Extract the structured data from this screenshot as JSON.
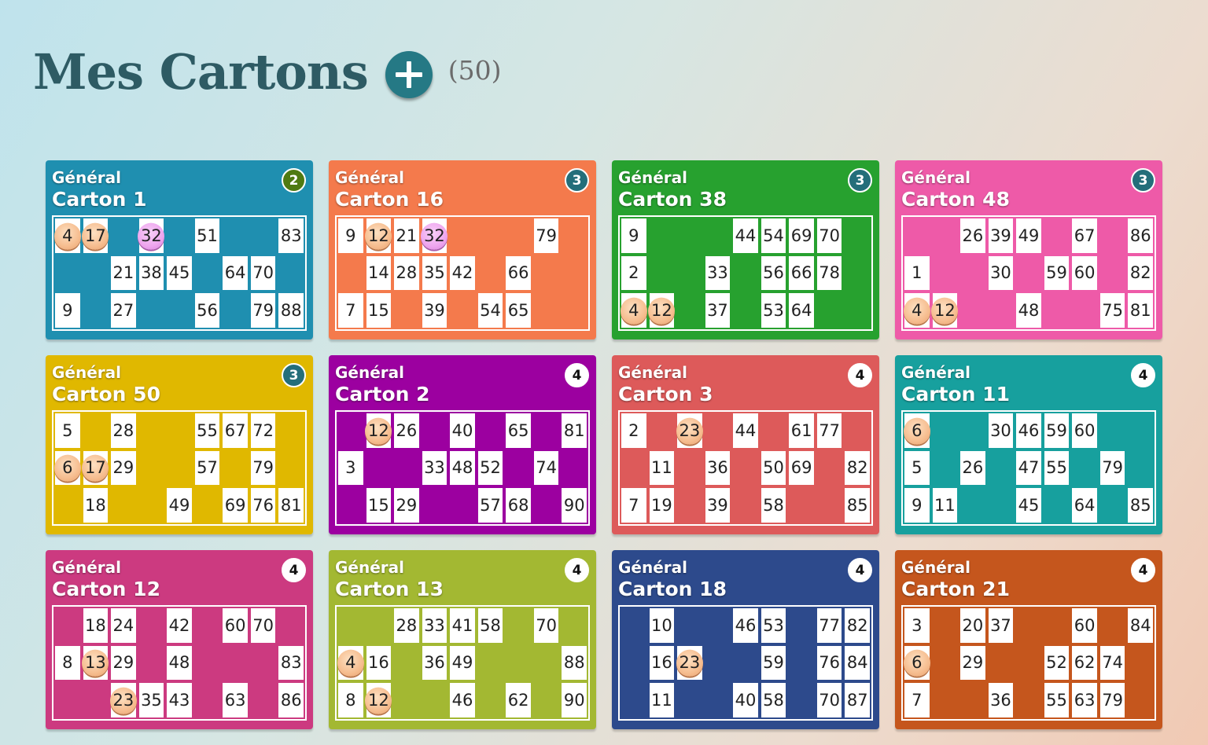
{
  "header": {
    "title": "Mes Cartons",
    "count": "(50)"
  },
  "icons": {
    "add": "plus-icon"
  },
  "cards": [
    {
      "category": "Général",
      "title": "Carton 1",
      "badge": "2",
      "color": "#1f8fb0",
      "badge_color": "#4f7a12",
      "rows": [
        [
          "4*",
          "17*",
          "",
          "32p",
          "",
          "51",
          "",
          "",
          "83"
        ],
        [
          "",
          "",
          "21",
          "38",
          "45",
          "",
          "64",
          "70",
          ""
        ],
        [
          "9",
          "",
          "27",
          "",
          "",
          "56",
          "",
          "79",
          "88"
        ]
      ]
    },
    {
      "category": "Général",
      "title": "Carton 16",
      "badge": "3",
      "color": "#f47a4c",
      "badge_color": "#246e7a",
      "rows": [
        [
          "9",
          "12*",
          "21",
          "32p",
          "",
          "",
          "",
          "79",
          ""
        ],
        [
          "",
          "14",
          "28",
          "35",
          "42",
          "",
          "66",
          "",
          ""
        ],
        [
          "7",
          "15",
          "",
          "39",
          "",
          "54",
          "65",
          "",
          ""
        ]
      ]
    },
    {
      "category": "Général",
      "title": "Carton 38",
      "badge": "3",
      "color": "#27a12f",
      "badge_color": "#246e7a",
      "rows": [
        [
          "9",
          "",
          "",
          "",
          "44",
          "54",
          "69",
          "70",
          ""
        ],
        [
          "2",
          "",
          "",
          "33",
          "",
          "56",
          "66",
          "78",
          ""
        ],
        [
          "4*",
          "12*",
          "",
          "37",
          "",
          "53",
          "64",
          "",
          ""
        ]
      ]
    },
    {
      "category": "Général",
      "title": "Carton 48",
      "badge": "3",
      "color": "#ee5aa8",
      "badge_color": "#246e7a",
      "rows": [
        [
          "",
          "",
          "26",
          "39",
          "49",
          "",
          "67",
          "",
          "86"
        ],
        [
          "1",
          "",
          "",
          "30",
          "",
          "59",
          "60",
          "",
          "82"
        ],
        [
          "4*",
          "12*",
          "",
          "",
          "48",
          "",
          "",
          "75",
          "81"
        ]
      ]
    },
    {
      "category": "Général",
      "title": "Carton 50",
      "badge": "3",
      "color": "#e0b800",
      "badge_color": "#246e7a",
      "rows": [
        [
          "5",
          "",
          "28",
          "",
          "",
          "55",
          "67",
          "72",
          ""
        ],
        [
          "6*",
          "17*",
          "29",
          "",
          "",
          "57",
          "",
          "79",
          ""
        ],
        [
          "",
          "18",
          "",
          "",
          "49",
          "",
          "69",
          "76",
          "81"
        ]
      ]
    },
    {
      "category": "Général",
      "title": "Carton 2",
      "badge": "4",
      "color": "#9c00a0",
      "badge_color": "#ffffff",
      "rows": [
        [
          "",
          "12*",
          "26",
          "",
          "40",
          "",
          "65",
          "",
          "81"
        ],
        [
          "3",
          "",
          "",
          "33",
          "48",
          "52",
          "",
          "74",
          ""
        ],
        [
          "",
          "15",
          "29",
          "",
          "",
          "57",
          "68",
          "",
          "90"
        ]
      ]
    },
    {
      "category": "Général",
      "title": "Carton 3",
      "badge": "4",
      "color": "#dd5a5a",
      "badge_color": "#ffffff",
      "rows": [
        [
          "2",
          "",
          "23*",
          "",
          "44",
          "",
          "61",
          "77",
          ""
        ],
        [
          "",
          "11",
          "",
          "36",
          "",
          "50",
          "69",
          "",
          "82"
        ],
        [
          "7",
          "19",
          "",
          "39",
          "",
          "58",
          "",
          "",
          "85"
        ]
      ]
    },
    {
      "category": "Général",
      "title": "Carton 11",
      "badge": "4",
      "color": "#17a09e",
      "badge_color": "#ffffff",
      "rows": [
        [
          "6*",
          "",
          "",
          "30",
          "46",
          "59",
          "60",
          "",
          ""
        ],
        [
          "5",
          "",
          "26",
          "",
          "47",
          "55",
          "",
          "79",
          ""
        ],
        [
          "9",
          "11",
          "",
          "",
          "45",
          "",
          "64",
          "",
          "85"
        ]
      ]
    },
    {
      "category": "Général",
      "title": "Carton 12",
      "badge": "4",
      "color": "#cc3a80",
      "badge_color": "#ffffff",
      "rows": [
        [
          "",
          "18",
          "24",
          "",
          "42",
          "",
          "60",
          "70",
          ""
        ],
        [
          "8",
          "13*",
          "29",
          "",
          "48",
          "",
          "",
          "",
          "83"
        ],
        [
          "",
          "",
          "23*",
          "35",
          "43",
          "",
          "63",
          "",
          "86"
        ]
      ]
    },
    {
      "category": "Général",
      "title": "Carton 13",
      "badge": "4",
      "color": "#a3b832",
      "badge_color": "#ffffff",
      "rows": [
        [
          "",
          "",
          "28",
          "33",
          "41",
          "58",
          "",
          "70",
          ""
        ],
        [
          "4*",
          "16",
          "",
          "36",
          "49",
          "",
          "",
          "",
          "88"
        ],
        [
          "8",
          "12*",
          "",
          "",
          "46",
          "",
          "62",
          "",
          "90"
        ]
      ]
    },
    {
      "category": "Général",
      "title": "Carton 18",
      "badge": "4",
      "color": "#2d4a8c",
      "badge_color": "#ffffff",
      "rows": [
        [
          "",
          "10",
          "",
          "",
          "46",
          "53",
          "",
          "77",
          "82"
        ],
        [
          "",
          "16",
          "23*",
          "",
          "",
          "59",
          "",
          "76",
          "84"
        ],
        [
          "",
          "11",
          "",
          "",
          "40",
          "58",
          "",
          "70",
          "87"
        ]
      ]
    },
    {
      "category": "Général",
      "title": "Carton 21",
      "badge": "4",
      "color": "#c5561d",
      "badge_color": "#ffffff",
      "rows": [
        [
          "3",
          "",
          "20",
          "37",
          "",
          "",
          "60",
          "",
          "84"
        ],
        [
          "6*",
          "",
          "29",
          "",
          "",
          "52",
          "62",
          "74",
          ""
        ],
        [
          "7",
          "",
          "",
          "36",
          "",
          "55",
          "63",
          "79",
          ""
        ]
      ]
    }
  ]
}
